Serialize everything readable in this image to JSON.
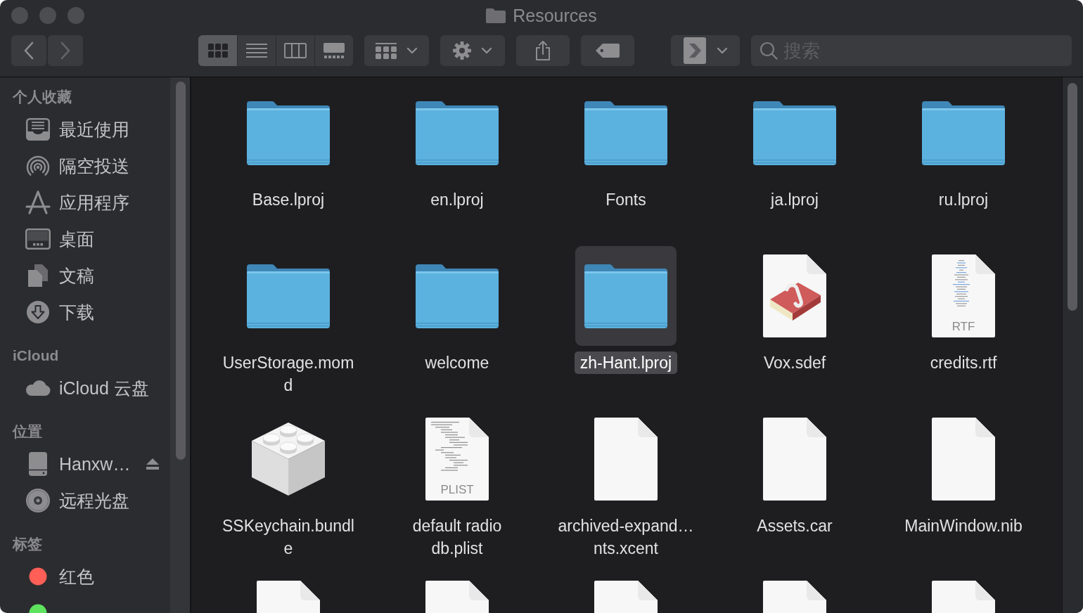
{
  "window": {
    "title": "Resources"
  },
  "toolbar": {
    "navigation": [
      {
        "kind": "back",
        "disabled": false
      },
      {
        "kind": "forward",
        "disabled": true
      }
    ],
    "view_modes": [
      {
        "kind": "icons",
        "selected": true
      },
      {
        "kind": "list",
        "selected": false
      },
      {
        "kind": "columns",
        "selected": false
      },
      {
        "kind": "gallery",
        "selected": false
      }
    ],
    "buttons": [
      {
        "kind": "group",
        "menu": true
      },
      {
        "kind": "action",
        "menu": true
      },
      {
        "kind": "share",
        "menu": false
      },
      {
        "kind": "tag",
        "menu": false
      },
      {
        "kind": "app",
        "menu": true
      }
    ],
    "search": {
      "placeholder": "搜索"
    }
  },
  "sidebar": {
    "sections": [
      {
        "title": "个人收藏",
        "items": [
          {
            "kind": "recents",
            "label": "最近使用",
            "selected": false
          },
          {
            "kind": "airdrop",
            "label": "隔空投送",
            "selected": false
          },
          {
            "kind": "applications",
            "label": "应用程序",
            "selected": false
          },
          {
            "kind": "desktop",
            "label": "桌面",
            "selected": false
          },
          {
            "kind": "documents",
            "label": "文稿",
            "selected": false
          },
          {
            "kind": "downloads",
            "label": "下载",
            "selected": false
          }
        ]
      },
      {
        "title": "iCloud",
        "items": [
          {
            "kind": "icloud",
            "label": "iCloud 云盘",
            "selected": false
          }
        ]
      },
      {
        "title": "位置",
        "items": [
          {
            "kind": "disk",
            "label": "Hanxw…",
            "selected": false
          },
          {
            "kind": "optical",
            "label": "远程光盘",
            "selected": false
          }
        ]
      },
      {
        "title": "标签",
        "items": [
          {
            "kind": "tag",
            "label": "红色",
            "color": "#ff5f57",
            "selected": false
          },
          {
            "kind": "tag",
            "color": "#5fe35f",
            "selected": false
          }
        ]
      }
    ]
  },
  "files": [
    {
      "kind": "folder",
      "name": "Base.lproj",
      "selected": false
    },
    {
      "kind": "folder",
      "name": "en.lproj",
      "selected": false
    },
    {
      "kind": "folder",
      "name": "Fonts",
      "selected": false
    },
    {
      "kind": "folder",
      "name": "ja.lproj",
      "selected": false
    },
    {
      "kind": "folder",
      "name": "ru.lproj",
      "selected": false
    },
    {
      "kind": "folder",
      "name": "UserStorage.momd",
      "selected": false
    },
    {
      "kind": "folder",
      "name": "welcome",
      "selected": false
    },
    {
      "kind": "folder",
      "name": "zh-Hant.lproj",
      "selected": true
    },
    {
      "kind": "sdef",
      "name": "Vox.sdef",
      "selected": false
    },
    {
      "kind": "rtf",
      "name": "credits.rtf",
      "badge": "RTF",
      "selected": false
    },
    {
      "kind": "bundle",
      "name": "SSKeychain.bundle",
      "selected": false
    },
    {
      "kind": "plist",
      "name": "default radio db.plist",
      "badge": "PLIST",
      "selected": false
    },
    {
      "kind": "blank",
      "name": "archived-expand…nts.xcent",
      "selected": false
    },
    {
      "kind": "blank",
      "name": "Assets.car",
      "selected": false
    },
    {
      "kind": "blank",
      "name": "MainWindow.nib",
      "selected": false
    },
    {
      "kind": "blank",
      "selected": false
    },
    {
      "kind": "blank",
      "selected": false
    },
    {
      "kind": "blank",
      "selected": false
    },
    {
      "kind": "blank",
      "selected": false
    },
    {
      "kind": "blank",
      "selected": false
    }
  ]
}
